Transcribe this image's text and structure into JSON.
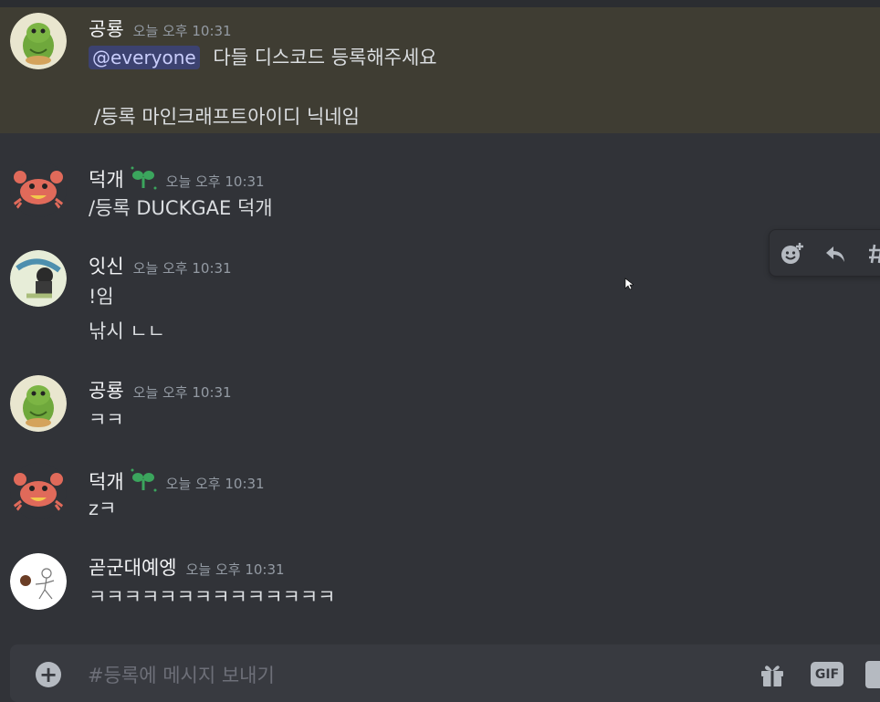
{
  "users": {
    "gongryong": "공룡",
    "deokgae": "덕개",
    "itsin": "잇신",
    "gotgun": "곧군대예엥"
  },
  "messages": [
    {
      "author": "공룡",
      "timestamp": "오늘 오후 10:31",
      "mention": "@everyone",
      "line1": "다들 디스코드 등록해주세요",
      "line2": "/등록 마인크래프트아이디 닉네임"
    },
    {
      "author": "덕개",
      "timestamp": "오늘 오후 10:31",
      "line1": "/등록 DUCKGAE 덕개"
    },
    {
      "author": "잇신",
      "timestamp": "오늘 오후 10:31",
      "line1": "!임",
      "line2": "낚시 ㄴㄴ"
    },
    {
      "author": "공룡",
      "timestamp": "오늘 오후 10:31",
      "line1": "ㅋㅋ"
    },
    {
      "author": "덕개",
      "timestamp": "오늘 오후 10:31",
      "line1": "zㅋ"
    },
    {
      "author": "곧군대예엥",
      "timestamp": "오늘 오후 10:31",
      "line1": "ㅋㅋㅋㅋㅋㅋㅋㅋㅋㅋㅋㅋㅋㅋ"
    }
  ],
  "composer": {
    "placeholder": "#등록에 메시지 보내기",
    "gif_label": "GIF"
  },
  "icons": {
    "add": "plus-circle-icon",
    "gift": "gift-icon",
    "sticker": "sticker-icon",
    "reaction": "add-reaction-icon",
    "reply": "reply-icon",
    "thread": "thread-icon"
  },
  "colors": {
    "background": "#313338",
    "mention_highlight": "#3f3d33",
    "mention_pill": "#3c4270",
    "timestamp": "#949ba4"
  }
}
